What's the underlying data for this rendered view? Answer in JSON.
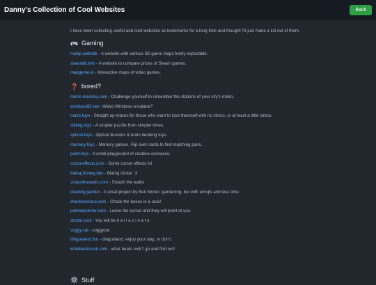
{
  "header": {
    "title": "Danny's Collection of Cool Websites",
    "back_label": "Back"
  },
  "intro": "I have been collecting useful and cool websites as bookmarks for a long time and thought I'd just make a list out of them.",
  "sections": [
    {
      "title": "Gaming",
      "icon": "gamepad-icon",
      "entries": [
        {
          "link": "noclip.website",
          "desc": " - A website with various 3D game maps freely explorable."
        },
        {
          "link": "steamdb.info",
          "desc": " - A website to compare prices of Steam games."
        },
        {
          "link": "mapgenie.io",
          "desc": " - Interactive maps of video games."
        }
      ]
    },
    {
      "title": "bored?",
      "icon": "question-mark-icon",
      "entries": [
        {
          "link": "metro-memory.com",
          "desc": " - Challenge yourself to remember the stations of your city's metro."
        },
        {
          "link": "windows93.net",
          "desc": " - Weird Windows emulator?"
        },
        {
          "link": "maze.toys",
          "desc": " - Straight up mazes for those who want to lose themself with no stress, or at least a little stress."
        },
        {
          "link": "sliding.toys",
          "desc": " - A simpler puzzle from simpler times."
        },
        {
          "link": "optical.toys",
          "desc": " - Optical illusions & brain bending toys."
        },
        {
          "link": "memory.toys",
          "desc": " - Memory games. Flip over cards to find matching pairs."
        },
        {
          "link": "point.toys",
          "desc": " - A small playground of creative canvases."
        },
        {
          "link": "cursoreffects.com",
          "desc": " - Some cursor effects lol"
        },
        {
          "link": "blahaj.finnley.dev",
          "desc": " - Blahaj clicker :3"
        },
        {
          "link": "smashthewalls.com",
          "desc": " - Smash the walls!"
        },
        {
          "link": "drawing.garden",
          "desc": " - A small project by Ben Moren: gardening, but with emojis and less time."
        },
        {
          "link": "checkboxrace.com",
          "desc": " - Check the boxes in a race!"
        },
        {
          "link": "pointerpointer.com",
          "desc": " - Leave the cursor and they will point at you."
        },
        {
          "link": "strobe.cool",
          "desc": " - You will be h a l l u c i n a t e"
        },
        {
          "link": "soggy.cat",
          "desc": " - soggycat"
        },
        {
          "link": "dingusland.fun",
          "desc": " - dingusland. enjoy your stay, or don't."
        },
        {
          "link": "whatbeatsrock.com",
          "desc": " - what beats rock? go and find out!"
        }
      ]
    }
  ],
  "next_section": {
    "title": "Stuff",
    "icon": "gear-icon"
  },
  "colors": {
    "background": "#22272e",
    "header": "#161b22",
    "link": "#58a6ff",
    "button": "#2ea043"
  }
}
